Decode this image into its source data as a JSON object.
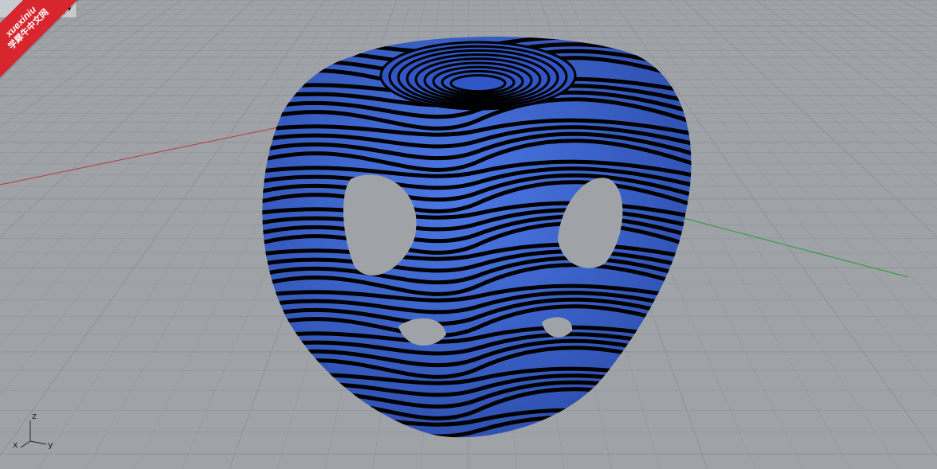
{
  "viewport": {
    "tab_label": "ve",
    "dropdown_icon": "chevron-down-icon"
  },
  "watermark": {
    "line1": "xuexiniu",
    "line2": "学犀牛中文网"
  },
  "axis_widget": {
    "z": "z",
    "x": "x",
    "y": "y"
  },
  "colors": {
    "background": "#9fa3a8",
    "grid": "#8d9196",
    "x_axis": "#b33a3a",
    "y_axis": "#2a9a2a",
    "model_blue": "#3a68d6",
    "model_stripe": "#000000"
  }
}
